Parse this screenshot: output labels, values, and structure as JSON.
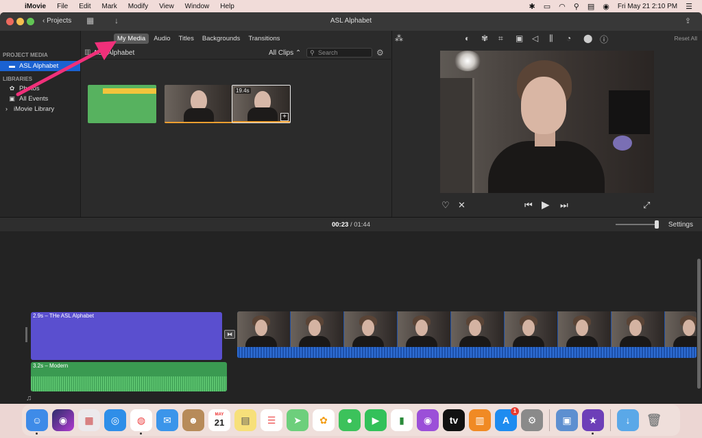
{
  "menubar": {
    "app_name": "iMovie",
    "menus": [
      "File",
      "Edit",
      "Mark",
      "Modify",
      "View",
      "Window",
      "Help"
    ],
    "clock": "Fri May 21  2:10 PM"
  },
  "window": {
    "title": "ASL Alphabet",
    "projects_label": "Projects"
  },
  "media_tabs": [
    {
      "label": "My Media",
      "active": true
    },
    {
      "label": "Audio",
      "active": false
    },
    {
      "label": "Titles",
      "active": false
    },
    {
      "label": "Backgrounds",
      "active": false
    },
    {
      "label": "Transitions",
      "active": false
    }
  ],
  "sidebar": {
    "project_media_header": "PROJECT MEDIA",
    "project_item": "ASL Alphabet",
    "libraries_header": "LIBRARIES",
    "libraries": [
      "Photos",
      "All Events",
      "iMovie Library"
    ]
  },
  "browser": {
    "title": "ASL Alphabet",
    "filter_label": "All Clips",
    "search_placeholder": "Search",
    "clip_duration_label": "19.4s",
    "add_symbol": "+"
  },
  "viewer": {
    "reset_label": "Reset All"
  },
  "timeline": {
    "current_time": "00:23",
    "separator": "/",
    "total_time": "01:44",
    "settings_label": "Settings",
    "title_clip_label": "2.9s – THe ASL Alphabet",
    "music_clip_label": "3.2s – Modern"
  },
  "dock": {
    "calendar_month": "MAY",
    "calendar_day": "21",
    "appstore_badge": "1"
  },
  "colors": {
    "selection_blue": "#1b62d1",
    "title_clip": "#5a4fcf",
    "music_clip": "#3a9a51",
    "video_clip": "#1c4fa8",
    "annotation_arrow": "#f0307a"
  }
}
